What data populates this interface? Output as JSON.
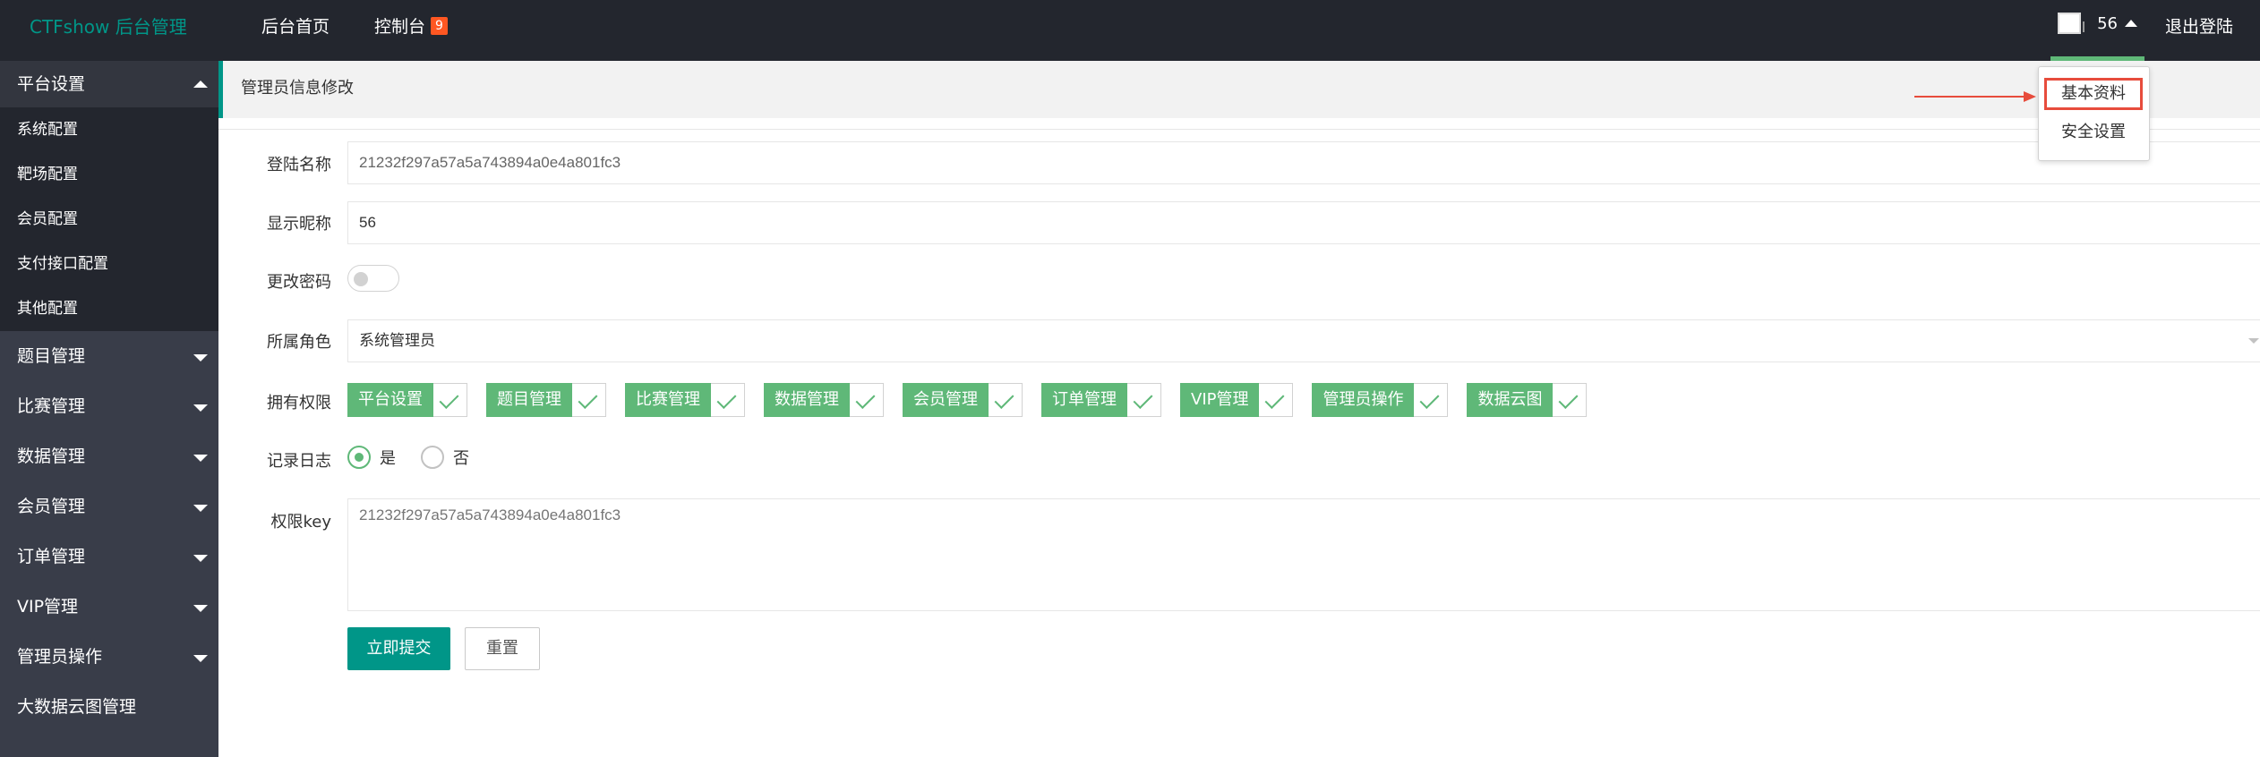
{
  "header": {
    "logo": "CTFshow 后台管理",
    "nav": [
      {
        "label": "后台首页"
      },
      {
        "label": "控制台",
        "badge": "9"
      }
    ],
    "user": {
      "name": "56"
    },
    "logout": "退出登陆",
    "accent_color": "#009688",
    "badge_color": "#ff5722"
  },
  "user_dropdown": {
    "items": [
      {
        "label": "基本资料",
        "highlighted": true
      },
      {
        "label": "安全设置"
      }
    ]
  },
  "sidebar": {
    "groups": [
      {
        "label": "平台设置",
        "expanded": true,
        "children": [
          {
            "label": "系统配置"
          },
          {
            "label": "靶场配置"
          },
          {
            "label": "会员配置"
          },
          {
            "label": "支付接口配置"
          },
          {
            "label": "其他配置"
          }
        ]
      },
      {
        "label": "题目管理"
      },
      {
        "label": "比赛管理"
      },
      {
        "label": "数据管理"
      },
      {
        "label": "会员管理"
      },
      {
        "label": "订单管理"
      },
      {
        "label": "VIP管理"
      },
      {
        "label": "管理员操作"
      },
      {
        "label": "大数据云图管理"
      }
    ]
  },
  "main": {
    "title": "管理员信息修改",
    "form": {
      "login_name": {
        "label": "登陆名称",
        "value": "21232f297a57a5a743894a0e4a801fc3"
      },
      "nickname": {
        "label": "显示昵称",
        "value": "56"
      },
      "change_password": {
        "label": "更改密码",
        "enabled": false
      },
      "role": {
        "label": "所属角色",
        "value": "系统管理员"
      },
      "permissions": {
        "label": "拥有权限",
        "items": [
          "平台设置",
          "题目管理",
          "比赛管理",
          "数据管理",
          "会员管理",
          "订单管理",
          "VIP管理",
          "管理员操作",
          "数据云图"
        ],
        "checked_color": "#5fb878"
      },
      "log": {
        "label": "记录日志",
        "options": [
          "是",
          "否"
        ],
        "selected": "是"
      },
      "perm_key": {
        "label": "权限key",
        "value": "21232f297a57a5a743894a0e4a801fc3"
      }
    },
    "submit_label": "立即提交",
    "reset_label": "重置"
  }
}
